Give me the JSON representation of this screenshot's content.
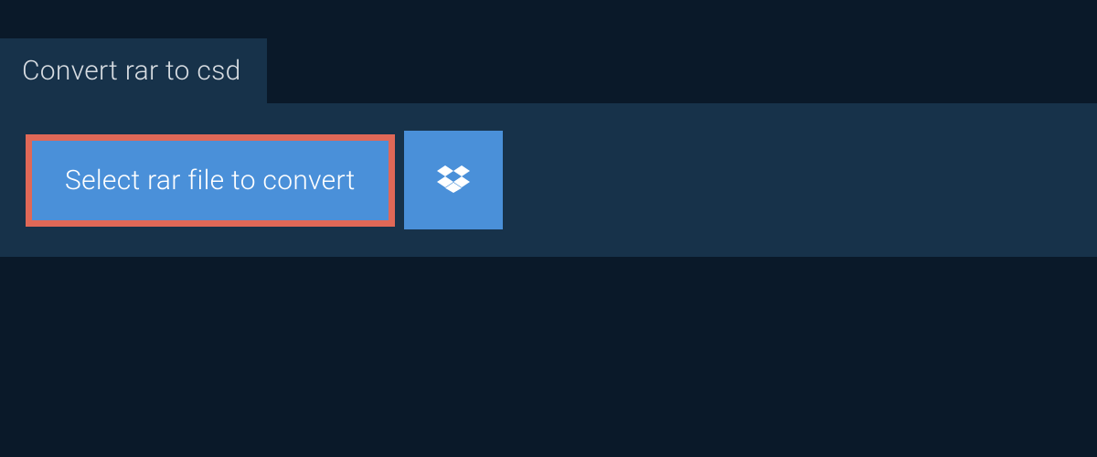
{
  "tab": {
    "label": "Convert rar to csd"
  },
  "actions": {
    "select_file_label": "Select rar file to convert"
  },
  "colors": {
    "background": "#0a1929",
    "panel": "#17324a",
    "button": "#4a90d9",
    "highlight_border": "#e06857",
    "text_light": "#d8dde2",
    "text_white": "#ffffff"
  }
}
